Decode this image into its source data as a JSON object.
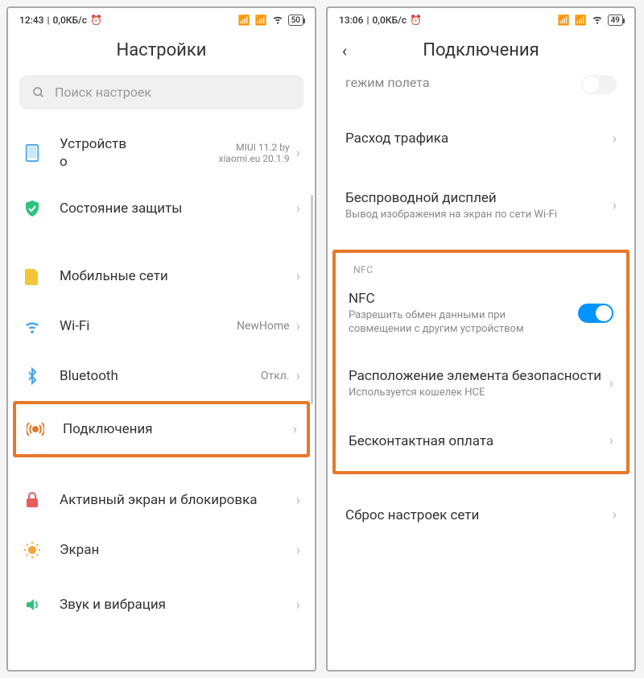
{
  "left": {
    "status": {
      "time": "12:43",
      "speed": "0,0КБ/с",
      "battery": "50"
    },
    "title": "Настройки",
    "search_placeholder": "Поиск настроек",
    "items": {
      "device": {
        "label": "Устройство",
        "value_line1": "MIUI 11.2 by",
        "value_line2": "xiaomi.eu 20.1.9"
      },
      "security": {
        "label": "Состояние защиты"
      },
      "sim": {
        "label": "Мобильные сети"
      },
      "wifi": {
        "label": "Wi-Fi",
        "value": "NewHome"
      },
      "bluetooth": {
        "label": "Bluetooth",
        "value": "Откл."
      },
      "connections": {
        "label": "Подключения"
      },
      "lock": {
        "label": "Активный экран и блокировка"
      },
      "display": {
        "label": "Экран"
      },
      "sound": {
        "label": "Звук и вибрация"
      }
    }
  },
  "right": {
    "status": {
      "time": "13:06",
      "speed": "0,0КБ/с",
      "battery": "49"
    },
    "title": "Подключения",
    "partial_top": "гежим полета",
    "items": {
      "traffic": {
        "label": "Расход трафика"
      },
      "wireless_display": {
        "label": "Беспроводной дисплей",
        "sub": "Вывод изображения на экран по сети Wi-Fi"
      },
      "nfc_header": "NFC",
      "nfc": {
        "label": "NFC",
        "sub": "Разрешить обмен данными при совмещении с другим устройством"
      },
      "secure_element": {
        "label": "Расположение элемента безопасности",
        "sub": "Используется кошелек HCE"
      },
      "contactless": {
        "label": "Бесконтактная оплата"
      },
      "reset": {
        "label": "Сброс настроек сети"
      }
    }
  }
}
